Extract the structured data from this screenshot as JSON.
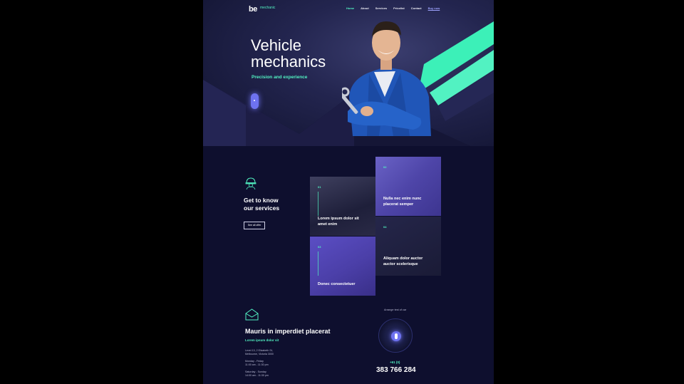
{
  "nav": {
    "logo_main": "be",
    "logo_sub": "mechanic",
    "links": [
      "Home",
      "About",
      "Services",
      "Pricelist",
      "Contact",
      "Buy now"
    ]
  },
  "hero": {
    "title_line1": "Vehicle",
    "title_line2": "mechanics",
    "subtitle": "Precision and experience"
  },
  "services": {
    "title_line1": "Get to know",
    "title_line2": "our services",
    "button": "See all offer",
    "tiles": [
      {
        "num": "01",
        "text": "Lorem ipsum dolor sit amet enim"
      },
      {
        "num": "02",
        "text": "Nulla nec enim nunc placerat semper"
      },
      {
        "num": "03",
        "text": "Donec consectetuer"
      },
      {
        "num": "04",
        "text": "Aliquam dolor auctor auctor scelerisque"
      }
    ]
  },
  "contact": {
    "title": "Mauris in imperdiet placerat",
    "subtitle": "Lorem ipsum dolor sit",
    "address1": "Level 13, 2 Elizabeth St,",
    "address2": "Melbourne, Victoria 3000",
    "days1": "Monday - Friday",
    "hours1": "11:00 am - 11:30 pm",
    "days2": "Saturday - Sunday",
    "hours2": "14:00 am - 11:30 pm",
    "answer": "Arrange test of car",
    "code": "+61 (0)",
    "phone": "383 766 284"
  },
  "colors": {
    "accent": "#52f2c2",
    "primary": "#6e72f0",
    "background": "#0e0f2e"
  }
}
